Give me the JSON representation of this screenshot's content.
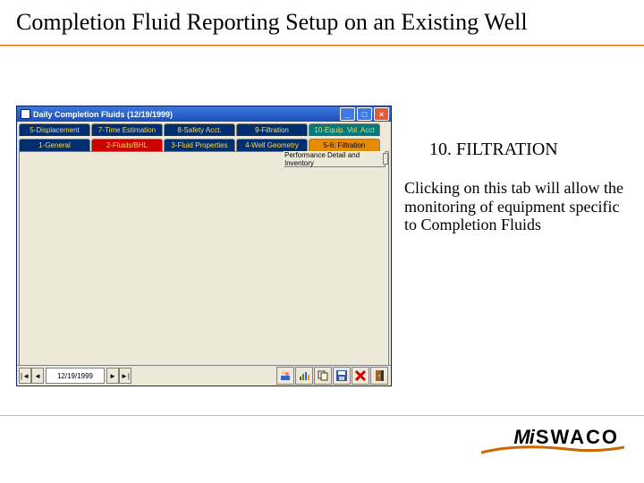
{
  "slide": {
    "title": "Completion Fluid Reporting Setup on an Existing Well",
    "step_heading": "10. FILTRATION",
    "step_body": "Clicking on this tab will allow the monitoring of equipment specific to Completion Fluids"
  },
  "logo": {
    "part1": "Mi",
    "part2": "SWACO"
  },
  "app": {
    "window_title": "Daily Completion Fluids (12/19/1999)",
    "tabs_row1": [
      {
        "label": "5-Displacement",
        "color": "navy"
      },
      {
        "label": "7-Time Estimation",
        "color": "navy"
      },
      {
        "label": "8-Safety Acct.",
        "color": "navy"
      },
      {
        "label": "9-Filtration",
        "color": "navy"
      },
      {
        "label": "10-Equip. Vol. Acct",
        "color": "teal"
      }
    ],
    "tabs_row2": [
      {
        "label": "1-General",
        "color": "navy"
      },
      {
        "label": "2-Fluids/BHL",
        "color": "red"
      },
      {
        "label": "3-Fluid Properties",
        "color": "navy"
      },
      {
        "label": "4-Well Geometry",
        "color": "navy"
      },
      {
        "label": "5-6: Filtration",
        "color": "amber"
      }
    ],
    "stack_button": "Performance Detail and Inventory",
    "date_field": "12/19/1999",
    "nav": {
      "first": "|◄",
      "prev": "◄",
      "next": "►",
      "last": "►|"
    },
    "toolbar_icons": [
      "people-icon",
      "chart-icon",
      "copy-icon",
      "save-disk-icon",
      "delete-icon",
      "close-door-icon"
    ]
  }
}
